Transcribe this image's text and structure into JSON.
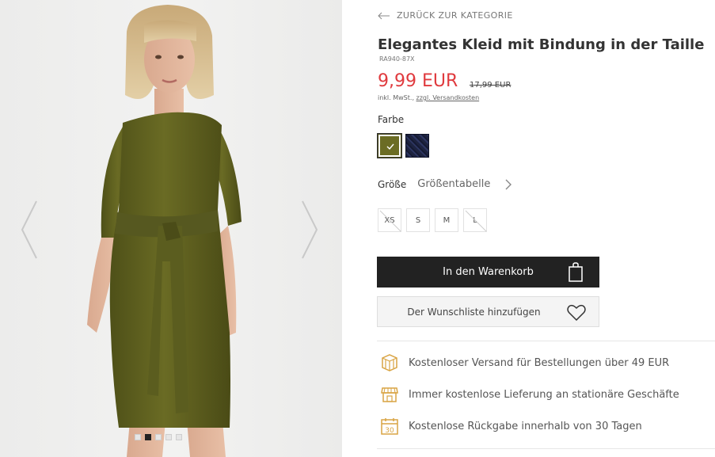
{
  "gallery": {
    "prev_label": "previous image",
    "next_label": "next image",
    "dots": [
      {
        "active": false
      },
      {
        "active": true
      },
      {
        "active": false
      },
      {
        "active": false
      },
      {
        "active": false
      }
    ]
  },
  "product": {
    "back_label": "ZURÜCK ZUR KATEGORIE",
    "title": "Elegantes Kleid mit Bindung in der Taille",
    "sku": "RA940-87X",
    "price": "9,99 EUR",
    "old_price": "17,99 EUR",
    "tax_prefix": "inkl. MwSt., ",
    "tax_link": "zzgl. Versandkosten",
    "color_label": "Farbe",
    "colors": [
      {
        "name": "olive",
        "hex": "#6b6c24",
        "selected": true
      },
      {
        "name": "navy",
        "hex": "#1d2340",
        "selected": false
      }
    ],
    "size_label": "Größe",
    "size_chart_label": "Größentabelle",
    "sizes": [
      {
        "label": "XS",
        "available": false
      },
      {
        "label": "S",
        "available": true
      },
      {
        "label": "M",
        "available": true
      },
      {
        "label": "L",
        "available": false
      }
    ],
    "cart_label": "In den Warenkorb",
    "wishlist_label": "Der Wunschliste hinzufügen"
  },
  "benefits": [
    {
      "icon": "shipping-box-icon",
      "text": "Kostenloser Versand für Bestellungen über 49 EUR"
    },
    {
      "icon": "store-icon",
      "text": "Immer kostenlose Lieferung an stationäre Geschäfte"
    },
    {
      "icon": "calendar-30-icon",
      "text": "Kostenlose Rückgabe innerhalb von 30 Tagen"
    }
  ],
  "colors": {
    "accent_price": "#e03a3e",
    "icon_gold": "#d9a443",
    "button_dark": "#222222"
  }
}
